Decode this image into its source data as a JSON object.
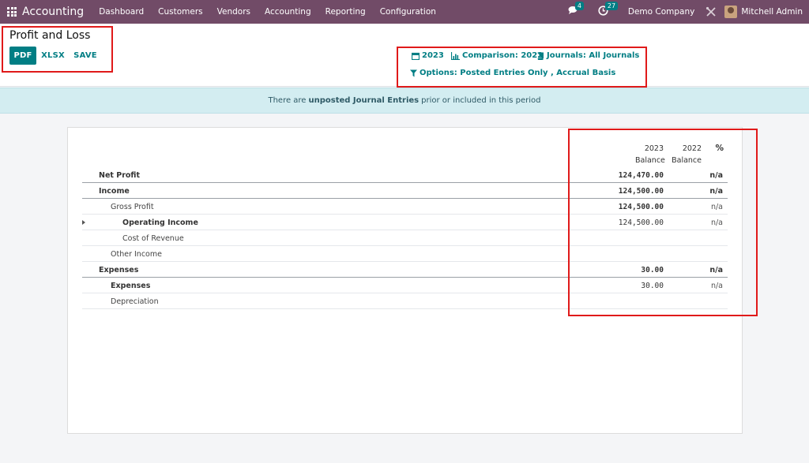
{
  "navbar": {
    "app_name": "Accounting",
    "menu": [
      "Dashboard",
      "Customers",
      "Vendors",
      "Accounting",
      "Reporting",
      "Configuration"
    ],
    "messages_count": "4",
    "activities_count": "27",
    "company": "Demo Company",
    "user": "Mitchell Admin",
    "bg_color": "#714b67"
  },
  "control_panel": {
    "title": "Profit and Loss",
    "pdf_label": "PDF",
    "xlsx_label": "XLSX",
    "save_label": "SAVE",
    "filters": {
      "date": "2023",
      "comparison": "Comparison: 2022",
      "journals": "Journals: All Journals",
      "options": "Options: Posted Entries Only , Accrual Basis"
    },
    "accent_color": "#017e84"
  },
  "banner": {
    "prefix": "There are",
    "link": "unposted Journal Entries",
    "suffix": "prior or included in this period"
  },
  "report": {
    "columns": [
      {
        "year": "2023",
        "label": "Balance"
      },
      {
        "year": "2022",
        "label": "Balance"
      }
    ],
    "percent_header": "%",
    "rows": [
      {
        "label": "Net Profit",
        "value": "124,470.00",
        "pct": "n/a"
      },
      {
        "label": "Income",
        "value": "124,500.00",
        "pct": "n/a"
      },
      {
        "label": "Gross Profit",
        "value": "124,500.00",
        "pct": "n/a"
      },
      {
        "label": "Operating Income",
        "value": "124,500.00",
        "pct": "n/a"
      },
      {
        "label": "Cost of Revenue",
        "value": "",
        "pct": ""
      },
      {
        "label": "Other Income",
        "value": "",
        "pct": ""
      },
      {
        "label": "Expenses",
        "value": "30.00",
        "pct": "n/a"
      },
      {
        "label": "Expenses",
        "value": "30.00",
        "pct": "n/a"
      },
      {
        "label": "Depreciation",
        "value": "",
        "pct": ""
      }
    ]
  },
  "annotation_color": "#e01a1a"
}
